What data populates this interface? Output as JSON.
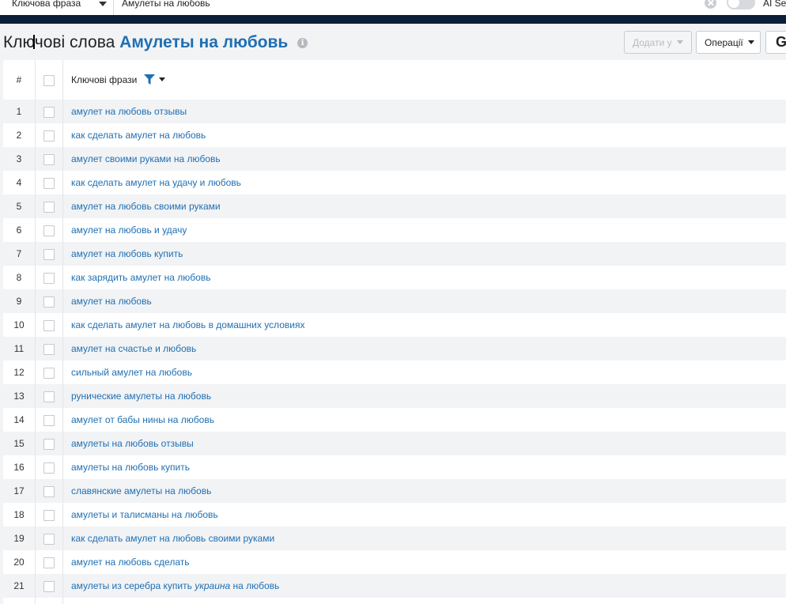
{
  "topbar": {
    "mode_select": "Ключова фраза",
    "search_value": "Амулеты на любовь",
    "ai_label": "AI Se"
  },
  "header": {
    "title_prefix": "Ключові слова",
    "title_query": "Амулеты на любовь",
    "info_glyph": "i",
    "add_button": "Додати у",
    "ops_button": "Операції",
    "g_button": "G"
  },
  "table": {
    "col_index": "#",
    "col_keywords": "Ключові фрази",
    "rows": [
      {
        "n": "1",
        "kw": "амулет на любовь отзывы"
      },
      {
        "n": "2",
        "kw": "как сделать амулет на любовь"
      },
      {
        "n": "3",
        "kw": "амулет своими руками на любовь"
      },
      {
        "n": "4",
        "kw": "как сделать амулет на удачу и любовь"
      },
      {
        "n": "5",
        "kw": "амулет на любовь своими руками"
      },
      {
        "n": "6",
        "kw": "амулет на любовь и удачу"
      },
      {
        "n": "7",
        "kw": "амулет на любовь купить"
      },
      {
        "n": "8",
        "kw": "как зарядить амулет на любовь"
      },
      {
        "n": "9",
        "kw": "амулет на любовь"
      },
      {
        "n": "10",
        "kw": "как сделать амулет на любовь в домашних условиях"
      },
      {
        "n": "11",
        "kw": "амулет на счастье и любовь"
      },
      {
        "n": "12",
        "kw": "сильный амулет на любовь"
      },
      {
        "n": "13",
        "kw": "рунические амулеты на любовь"
      },
      {
        "n": "14",
        "kw": "амулет от бабы нины на любовь"
      },
      {
        "n": "15",
        "kw": "амулеты на любовь отзывы"
      },
      {
        "n": "16",
        "kw": "амулеты на любовь купить"
      },
      {
        "n": "17",
        "kw": "славянские амулеты на любовь"
      },
      {
        "n": "18",
        "kw": "амулеты и талисманы на любовь"
      },
      {
        "n": "19",
        "kw": "как сделать амулет на любовь своими руками"
      },
      {
        "n": "20",
        "kw": "амулет на любовь сделать"
      },
      {
        "n": "21",
        "kw_before": "амулеты из серебра купить ",
        "kw_em": "украина",
        "kw_after": " на любовь"
      }
    ]
  },
  "colors": {
    "link": "#1f6fb3",
    "nav": "#0c1e3a",
    "row_alt": "#f2f3f5"
  }
}
